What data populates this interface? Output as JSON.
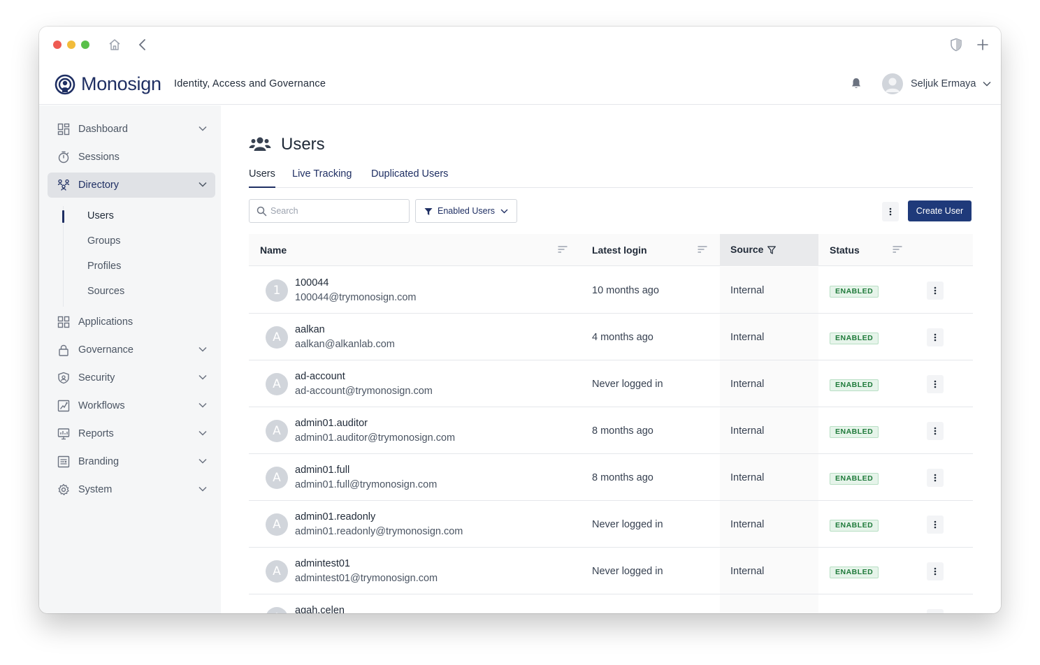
{
  "app": {
    "brand": "Monosign",
    "tagline": "Identity, Access and Governance",
    "user_name": "Seljuk Ermaya"
  },
  "sidebar": {
    "items": [
      {
        "key": "dashboard",
        "label": "Dashboard",
        "icon": "dashboard-icon",
        "chevron": true
      },
      {
        "key": "sessions",
        "label": "Sessions",
        "icon": "stopwatch-icon",
        "chevron": false
      },
      {
        "key": "directory",
        "label": "Directory",
        "icon": "directory-icon",
        "chevron": true,
        "active": true
      },
      {
        "key": "applications",
        "label": "Applications",
        "icon": "apps-grid-icon",
        "chevron": false
      },
      {
        "key": "governance",
        "label": "Governance",
        "icon": "lock-icon",
        "chevron": true
      },
      {
        "key": "security",
        "label": "Security",
        "icon": "shield-icon",
        "chevron": true
      },
      {
        "key": "workflows",
        "label": "Workflows",
        "icon": "workflow-icon",
        "chevron": true
      },
      {
        "key": "reports",
        "label": "Reports",
        "icon": "reports-icon",
        "chevron": true
      },
      {
        "key": "branding",
        "label": "Branding",
        "icon": "branding-icon",
        "chevron": true
      },
      {
        "key": "system",
        "label": "System",
        "icon": "gear-icon",
        "chevron": true
      }
    ],
    "directory_sub": [
      {
        "label": "Users",
        "active": true
      },
      {
        "label": "Groups"
      },
      {
        "label": "Profiles"
      },
      {
        "label": "Sources"
      }
    ]
  },
  "page": {
    "title": "Users",
    "tabs": [
      "Users",
      "Live Tracking",
      "Duplicated Users"
    ],
    "search_placeholder": "Search",
    "filter_label": "Enabled Users",
    "create_label": "Create User"
  },
  "table": {
    "columns": {
      "name": "Name",
      "login": "Latest login",
      "source": "Source",
      "status": "Status"
    },
    "rows": [
      {
        "initial": "1",
        "name": "100044",
        "email": "100044@trymonosign.com",
        "login": "10 months ago",
        "source": "Internal",
        "status": "ENABLED"
      },
      {
        "initial": "A",
        "name": "aalkan",
        "email": "aalkan@alkanlab.com",
        "login": "4 months ago",
        "source": "Internal",
        "status": "ENABLED"
      },
      {
        "initial": "A",
        "name": "ad-account",
        "email": "ad-account@trymonosign.com",
        "login": "Never logged in",
        "source": "Internal",
        "status": "ENABLED"
      },
      {
        "initial": "A",
        "name": "admin01.auditor",
        "email": "admin01.auditor@trymonosign.com",
        "login": "8 months ago",
        "source": "Internal",
        "status": "ENABLED"
      },
      {
        "initial": "A",
        "name": "admin01.full",
        "email": "admin01.full@trymonosign.com",
        "login": "8 months ago",
        "source": "Internal",
        "status": "ENABLED"
      },
      {
        "initial": "A",
        "name": "admin01.readonly",
        "email": "admin01.readonly@trymonosign.com",
        "login": "Never logged in",
        "source": "Internal",
        "status": "ENABLED"
      },
      {
        "initial": "A",
        "name": "admintest01",
        "email": "admintest01@trymonosign.com",
        "login": "Never logged in",
        "source": "Internal",
        "status": "ENABLED"
      },
      {
        "initial": "A",
        "name": "agah.celen",
        "email": "",
        "login": "",
        "source": "",
        "status": ""
      }
    ]
  },
  "colors": {
    "brand": "#1f2f63",
    "primary_button": "#1f3a7a",
    "enabled_badge": "#1e7a3a"
  }
}
